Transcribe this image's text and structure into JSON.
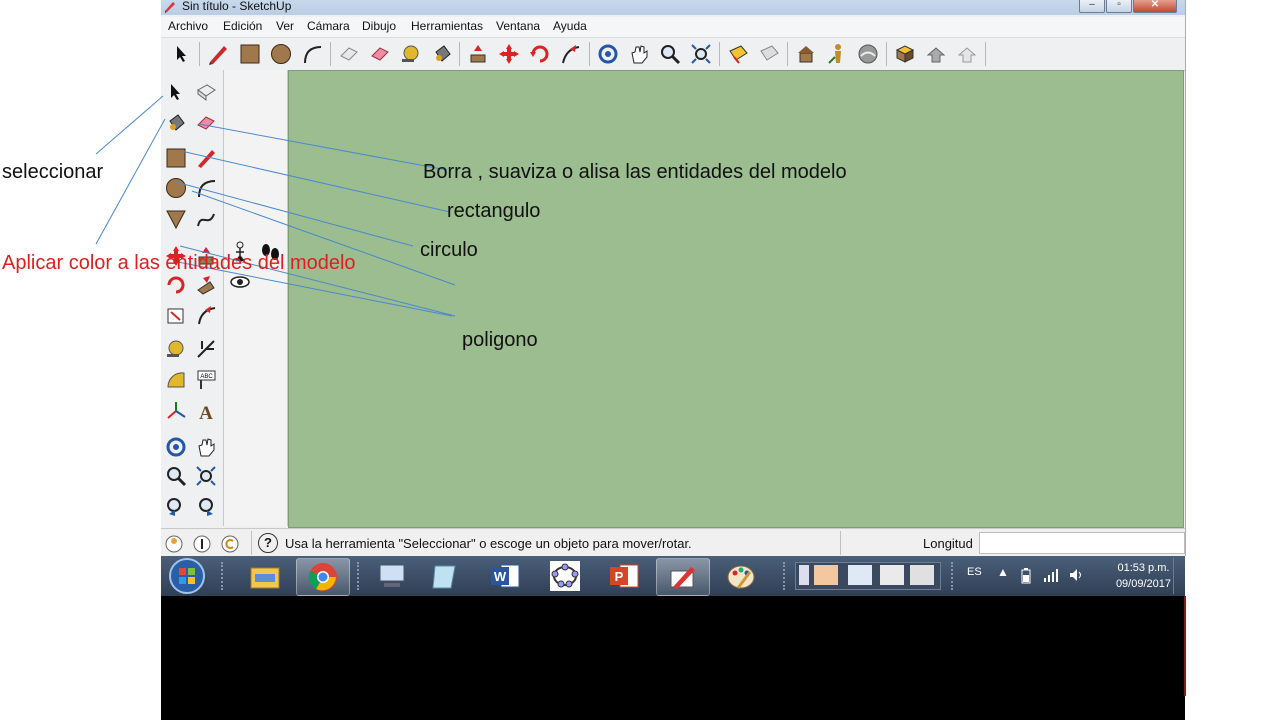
{
  "window": {
    "title": "Sin título - SketchUp",
    "controls": {
      "minimize": "‒",
      "maximize": "▫",
      "close": "✕"
    }
  },
  "menubar": {
    "items": [
      "Archivo",
      "Edición",
      "Ver",
      "Cámara",
      "Dibujo",
      "Herramientas",
      "Ventana",
      "Ayuda"
    ]
  },
  "toolbar": {
    "icons": [
      "select-arrow-icon",
      "pencil-icon",
      "rectangle-icon",
      "circle-icon",
      "arc-icon",
      "eraser-dim-icon",
      "eraser-icon",
      "tape-measure-icon",
      "paint-bucket-icon",
      "push-pull-icon",
      "move-icon",
      "rotate-icon",
      "follow-me-icon",
      "orbit-icon",
      "pan-icon",
      "zoom-icon",
      "zoom-extents-icon",
      "section-icon",
      "section-dim-icon",
      "warehouse-icon",
      "person-icon",
      "terrain-icon",
      "components-icon",
      "share-icon",
      "share-dim-icon"
    ]
  },
  "viewport": {
    "background": "#9bbd8f"
  },
  "statusbar": {
    "message": "Usa la herramienta \"Seleccionar\" o escoge un objeto para mover/rotar.",
    "measurement_label": "Longitud",
    "measurement_value": "",
    "help_glyph": "?"
  },
  "taskbar": {
    "apps": [
      "start-orb-icon",
      "file-explorer-icon",
      "chrome-icon",
      "remote-desktop-icon",
      "notes-icon",
      "word-icon",
      "geogebra-icon",
      "powerpoint-icon",
      "sketchup-icon",
      "paint-icon"
    ],
    "tray": {
      "language": "ES",
      "time": "01:53 p.m.",
      "date": "09/09/2017"
    }
  },
  "annotations": {
    "seleccionar": "seleccionar",
    "aplicar_color": "Aplicar color a las entidades del modelo",
    "borra": "Borra , suaviza o alisa las entidades del modelo",
    "rectangulo": "rectangulo",
    "circulo": "circulo",
    "poligono": "poligono"
  },
  "colors": {
    "annotation_black": "#111111",
    "annotation_red": "#dd1f1f",
    "leader_lines": "#4a89cc"
  }
}
